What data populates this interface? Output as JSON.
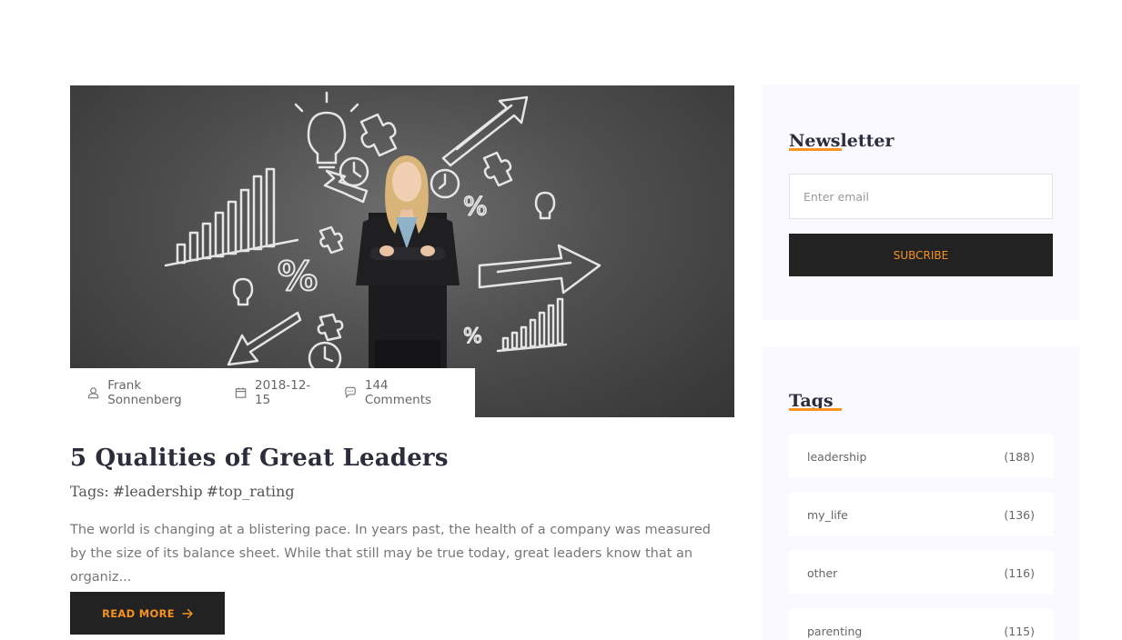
{
  "post": {
    "author": "Frank Sonnenberg",
    "date": "2018-12-15",
    "comments": "144 Comments",
    "title": "5 Qualities of Great Leaders",
    "tags_prefix": "Tags:",
    "tags": [
      "#leadership",
      "#top_rating"
    ],
    "excerpt": "The world is changing at a blistering pace. In years past, the health of a company was measured by the size of its balance sheet. While that still may be true today, great leaders know that an organiz...",
    "read_more_label": "READ MORE",
    "icons": {
      "author": "user-icon",
      "date": "calendar-icon",
      "comments": "comment-icon",
      "read_more": "arrow-right-icon"
    }
  },
  "newsletter": {
    "title": "Newsletter",
    "email_placeholder": "Enter email",
    "button_label": "SUBCRIBE"
  },
  "tags_widget": {
    "title": "Tags",
    "items": [
      {
        "name": "leadership",
        "count": "(188)"
      },
      {
        "name": "my_life",
        "count": "(136)"
      },
      {
        "name": "other",
        "count": "(116)"
      },
      {
        "name": "parenting",
        "count": "(115)"
      }
    ]
  },
  "colors": {
    "accent": "#f7931e",
    "dark": "#222222",
    "widget_bg": "#f9f9ff",
    "heading": "#2b2d3a"
  }
}
